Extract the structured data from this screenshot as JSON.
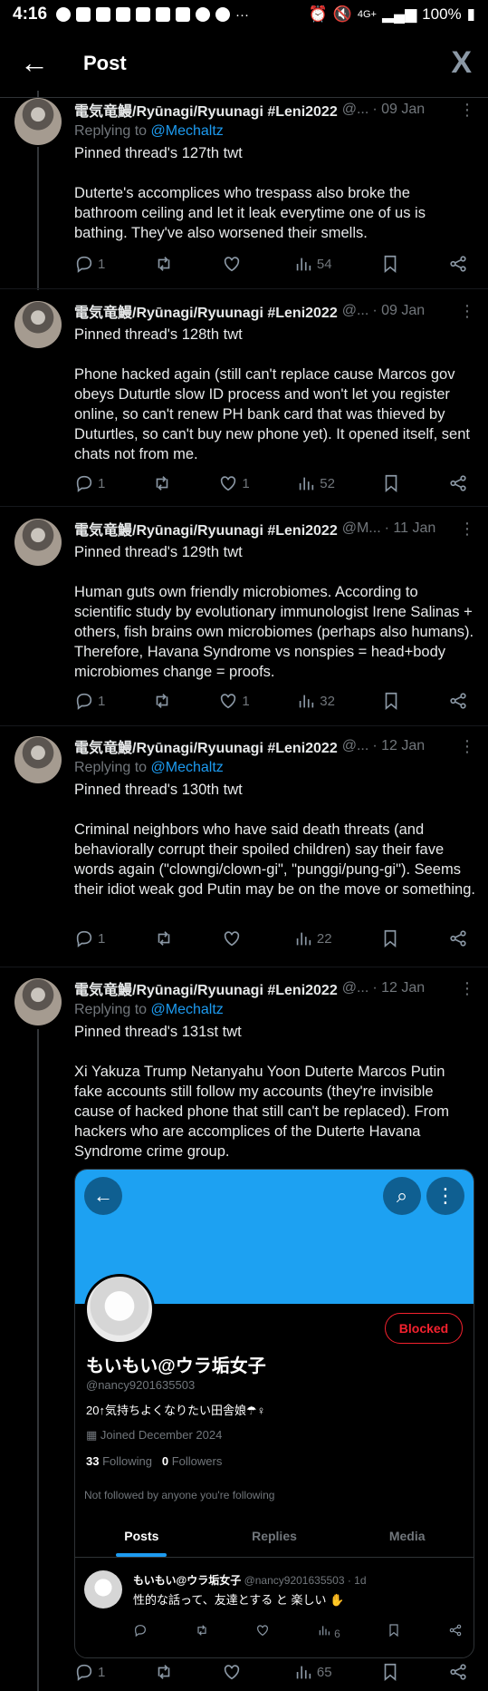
{
  "status_bar": {
    "time": "4:16",
    "more": "···",
    "network": "4G+",
    "battery": "100%"
  },
  "header": {
    "title": "Post"
  },
  "tweets": [
    {
      "name": "電気竜鰻/Ryūnagi/Ryuunagi #Leni2022",
      "handle": "@...",
      "date": "· 09 Jan",
      "replying_prefix": "Replying to",
      "replying_to": "@Mechaltz",
      "body": "Pinned thread's 127th twt\n\nDuterte's accomplices who trespass also broke the bathroom ceiling and let it leak everytime one of us is bathing. They've also worsened their smells.",
      "replies": "1",
      "reposts": "",
      "likes": "",
      "views": "54"
    },
    {
      "name": "電気竜鰻/Ryūnagi/Ryuunagi #Leni2022",
      "handle": "@...",
      "date": "· 09 Jan",
      "body": "Pinned thread's 128th twt\n\nPhone hacked again (still can't replace cause Marcos gov obeys Duturtle slow ID process and won't let you register online, so can't renew PH bank card that was thieved by Duturtles, so can't buy new phone yet). It opened itself, sent chats not from me.",
      "replies": "1",
      "reposts": "",
      "likes": "1",
      "views": "52"
    },
    {
      "name": "電気竜鰻/Ryūnagi/Ryuunagi #Leni2022",
      "handle": "@M...",
      "date": "· 11 Jan",
      "body": "Pinned thread's 129th twt\n\nHuman guts own friendly microbiomes. According to scientific study by evolutionary immunologist Irene Salinas + others, fish brains own microbiomes (perhaps also humans). Therefore, Havana Syndrome vs nonspies = head+body microbiomes change = proofs.",
      "replies": "1",
      "reposts": "",
      "likes": "1",
      "views": "32"
    },
    {
      "name": "電気竜鰻/Ryūnagi/Ryuunagi #Leni2022",
      "handle": "@...",
      "date": "· 12 Jan",
      "replying_prefix": "Replying to",
      "replying_to": "@Mechaltz",
      "body": "Pinned thread's 130th twt\n\nCriminal neighbors who have said death threats (and behaviorally corrupt their spoiled children) say their fave words again (\"clowngi/clown-gi\", \"punggi/pung-gi\"). Seems their idiot weak god Putin may be on the move or something.",
      "replies": "1",
      "reposts": "",
      "likes": "",
      "views": "22"
    },
    {
      "name": "電気竜鰻/Ryūnagi/Ryuunagi #Leni2022",
      "handle": "@...",
      "date": "· 12 Jan",
      "replying_prefix": "Replying to",
      "replying_to": "@Mechaltz",
      "body": "Pinned thread's 131st twt\n\nXi Yakuza Trump Netanyahu Yoon Duterte Marcos Putin fake accounts still follow my accounts (they're invisible cause of hacked phone that still can't be replaced). From hackers who are accomplices of the Duterte Havana Syndrome crime group.",
      "replies": "1",
      "reposts": "",
      "likes": "",
      "views": "65"
    }
  ],
  "embedded_profile": {
    "name": "もいもい@ウラ垢女子",
    "handle": "@nancy9201635503",
    "bio": "20↑気持ちよくなりたい田舎娘☂♀",
    "joined": "Joined December 2024",
    "following_count": "33",
    "following_label": "Following",
    "followers_count": "0",
    "followers_label": "Followers",
    "not_followed": "Not followed by anyone you're following",
    "blocked_label": "Blocked",
    "tabs": [
      "Posts",
      "Replies",
      "Media"
    ],
    "post": {
      "name": "もいもい@ウラ垢女子",
      "handle_date": "@nancy9201635503 · 1d",
      "text": "性的な話って、友達とする と 楽しい ✋",
      "views": "6"
    }
  }
}
